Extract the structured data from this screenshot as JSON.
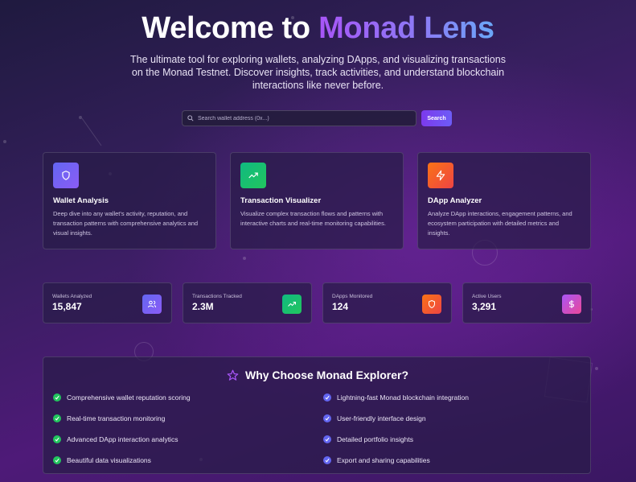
{
  "hero": {
    "title_prefix": "Welcome to ",
    "title_accent": "Monad Lens",
    "subtitle": "The ultimate tool for exploring wallets, analyzing DApps, and visualizing transactions on the Monad Testnet. Discover insights, track activities, and understand blockchain interactions like never before."
  },
  "search": {
    "placeholder": "Search wallet address (0x...)",
    "button_label": "Search"
  },
  "features": [
    {
      "title": "Wallet Analysis",
      "description": "Deep dive into any wallet's activity, reputation, and transaction patterns with comprehensive analytics and visual insights.",
      "icon": "shield-icon",
      "color_from": "#6366f1",
      "color_to": "#8b5cf6"
    },
    {
      "title": "Transaction Visualizer",
      "description": "Visualize complex transaction flows and patterns with interactive charts and real-time monitoring capabilities.",
      "icon": "trending-up-icon",
      "color_from": "#10b981",
      "color_to": "#22c55e"
    },
    {
      "title": "DApp Analyzer",
      "description": "Analyze DApp interactions, engagement patterns, and ecosystem participation with detailed metrics and insights.",
      "icon": "zap-icon",
      "color_from": "#f97316",
      "color_to": "#ef4444"
    }
  ],
  "stats": [
    {
      "label": "Wallets Analyzed",
      "value": "15,847",
      "icon": "users-icon",
      "color_from": "#6366f1",
      "color_to": "#8b5cf6"
    },
    {
      "label": "Transactions Tracked",
      "value": "2.3M",
      "icon": "trending-up-icon",
      "color_from": "#10b981",
      "color_to": "#22c55e"
    },
    {
      "label": "DApps Monitored",
      "value": "124",
      "icon": "shield-icon",
      "color_from": "#f97316",
      "color_to": "#ef4444"
    },
    {
      "label": "Active Users",
      "value": "3,291",
      "icon": "dollar-icon",
      "color_from": "#a855f7",
      "color_to": "#ec4899"
    }
  ],
  "why": {
    "title": "Why Choose Monad Explorer?",
    "left_items": [
      "Comprehensive wallet reputation scoring",
      "Real-time transaction monitoring",
      "Advanced DApp interaction analytics",
      "Beautiful data visualizations"
    ],
    "right_items": [
      "Lightning-fast Monad blockchain integration",
      "User-friendly interface design",
      "Detailed portfolio insights",
      "Export and sharing capabilities"
    ],
    "left_check_color": "#22c55e",
    "right_check_color": "#6366f1"
  }
}
